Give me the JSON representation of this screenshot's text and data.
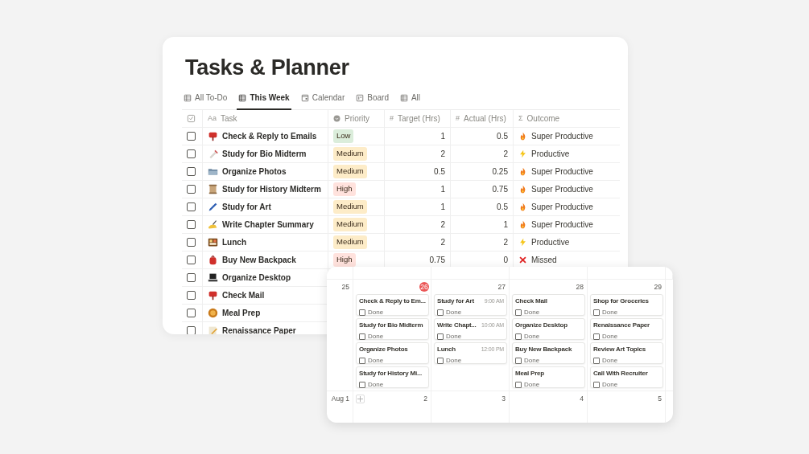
{
  "title": "Tasks & Planner",
  "tabs": [
    {
      "label": "All To-Do",
      "kind": "table",
      "selected": false
    },
    {
      "label": "This Week",
      "kind": "table",
      "selected": true
    },
    {
      "label": "Calendar",
      "kind": "calendar",
      "selected": false
    },
    {
      "label": "Board",
      "kind": "board",
      "selected": false
    },
    {
      "label": "All",
      "kind": "table",
      "selected": false
    }
  ],
  "columns": [
    {
      "kind": "checkbox"
    },
    {
      "kind": "title",
      "glyph": "Aa",
      "label": "Task"
    },
    {
      "kind": "select",
      "label": "Priority"
    },
    {
      "kind": "number",
      "glyph": "#",
      "label": "Target (Hrs)"
    },
    {
      "kind": "number",
      "glyph": "#",
      "label": "Actual (Hrs)"
    },
    {
      "kind": "formula",
      "glyph": "Σ",
      "label": "Outcome"
    }
  ],
  "rows": [
    {
      "checked": false,
      "task": "Check & Reply to Emails",
      "priority": {
        "label": "Low",
        "color": "#dbeddb"
      },
      "target": "1",
      "actual": "0.5",
      "outcome": {
        "kind": "fire",
        "label": "Super Productive"
      }
    },
    {
      "checked": false,
      "task": "Study for Bio Midterm",
      "priority": {
        "label": "Medium",
        "color": "#fdecc8"
      },
      "target": "2",
      "actual": "2",
      "outcome": {
        "kind": "bolt",
        "label": "Productive"
      }
    },
    {
      "checked": false,
      "task": "Organize Photos",
      "priority": {
        "label": "Medium",
        "color": "#fdecc8"
      },
      "target": "0.5",
      "actual": "0.25",
      "outcome": {
        "kind": "fire",
        "label": "Super Productive"
      }
    },
    {
      "checked": false,
      "task": "Study for History Midterm",
      "priority": {
        "label": "High",
        "color": "#ffe2dd"
      },
      "target": "1",
      "actual": "0.75",
      "outcome": {
        "kind": "fire",
        "label": "Super Productive"
      }
    },
    {
      "checked": false,
      "task": "Study for Art",
      "priority": {
        "label": "Medium",
        "color": "#fdecc8"
      },
      "target": "1",
      "actual": "0.5",
      "outcome": {
        "kind": "fire",
        "label": "Super Productive"
      }
    },
    {
      "checked": false,
      "task": "Write Chapter Summary",
      "priority": {
        "label": "Medium",
        "color": "#fdecc8"
      },
      "target": "2",
      "actual": "1",
      "outcome": {
        "kind": "fire",
        "label": "Super Productive"
      }
    },
    {
      "checked": false,
      "task": "Lunch",
      "priority": {
        "label": "Medium",
        "color": "#fdecc8"
      },
      "target": "2",
      "actual": "2",
      "outcome": {
        "kind": "bolt",
        "label": "Productive"
      }
    },
    {
      "checked": false,
      "task": "Buy New Backpack",
      "priority": {
        "label": "High",
        "color": "#ffe2dd"
      },
      "target": "0.75",
      "actual": "0",
      "outcome": {
        "kind": "cross",
        "label": "Missed"
      }
    },
    {
      "checked": false,
      "task": "Organize Desktop"
    },
    {
      "checked": false,
      "task": "Check Mail"
    },
    {
      "checked": false,
      "task": "Meal Prep"
    },
    {
      "checked": false,
      "task": "Renaissance Paper"
    }
  ],
  "calendar": {
    "weeks": [
      {
        "days": [
          {
            "label": "25",
            "today": false,
            "add": false
          },
          {
            "label": "26",
            "today": true,
            "add": false,
            "events": [
              {
                "title": "Check & Reply to Em...",
                "status": "Done",
                "checked": false
              },
              {
                "title": "Study for Bio Midterm",
                "status": "Done",
                "checked": false
              },
              {
                "title": "Organize Photos",
                "status": "Done",
                "checked": false
              },
              {
                "title": "Study for History Mi...",
                "status": "Done",
                "checked": false
              }
            ]
          },
          {
            "label": "27",
            "today": false,
            "add": false,
            "events": [
              {
                "title": "Study for Art",
                "time": "9:00 AM",
                "status": "Done",
                "checked": false
              },
              {
                "title": "Write Chapt...",
                "time": "10:00 AM",
                "status": "Done",
                "checked": false
              },
              {
                "title": "Lunch",
                "time": "12:00 PM",
                "status": "Done",
                "checked": false
              }
            ]
          },
          {
            "label": "28",
            "today": false,
            "add": false,
            "events": [
              {
                "title": "Check Mail",
                "status": "Done",
                "checked": false
              },
              {
                "title": "Organize Desktop",
                "status": "Done",
                "checked": false
              },
              {
                "title": "Buy New Backpack",
                "status": "Done",
                "checked": false
              },
              {
                "title": "Meal Prep",
                "status": "Done",
                "checked": false
              }
            ]
          },
          {
            "label": "29",
            "today": false,
            "add": false,
            "events": [
              {
                "title": "Shop for Groceries",
                "status": "Done",
                "checked": false
              },
              {
                "title": "Renaissance Paper",
                "status": "Done",
                "checked": false
              },
              {
                "title": "Review Art Topics",
                "status": "Done",
                "checked": false
              },
              {
                "title": "Call With Recruiter",
                "status": "Done",
                "checked": false
              }
            ]
          }
        ]
      },
      {
        "days": [
          {
            "label": "Aug 1",
            "today": false,
            "add": false
          },
          {
            "label": "2",
            "today": false,
            "add": true
          },
          {
            "label": "3",
            "today": false,
            "add": false
          },
          {
            "label": "4",
            "today": false,
            "add": false
          },
          {
            "label": "5",
            "today": false,
            "add": false
          }
        ]
      }
    ]
  }
}
